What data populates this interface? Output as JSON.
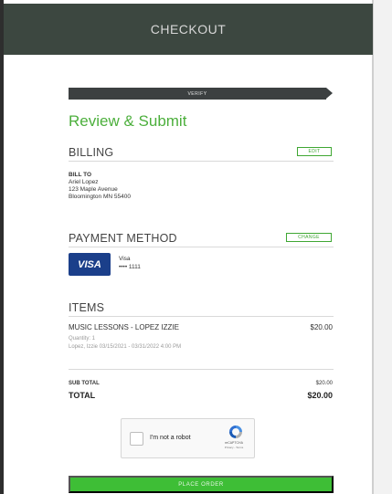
{
  "header": {
    "title": "CHECKOUT"
  },
  "steps": {
    "current": "VERIFY"
  },
  "page": {
    "title": "Review & Submit"
  },
  "billing": {
    "heading": "BILLING",
    "edit_label": "EDIT",
    "bill_to_label": "BILL TO",
    "name": "Ariel Lopez",
    "street": "123 Maple Avenue",
    "city_line": "Bloomington MN 55400"
  },
  "payment": {
    "heading": "PAYMENT METHOD",
    "change_label": "CHANGE",
    "card_brand_logo": "VISA",
    "card_type": "Visa",
    "card_masked": "•••• 1111"
  },
  "items": {
    "heading": "ITEMS",
    "list": [
      {
        "name": "MUSIC LESSONS - LOPEZ IZZIE",
        "price": "$20.00",
        "quantity": "Quantity: 1",
        "schedule": "Lopez, Izzie 03/15/2021 - 03/31/2022 4:00 PM"
      }
    ]
  },
  "summary": {
    "subtotal_label": "SUB TOTAL",
    "subtotal_value": "$20.00",
    "total_label": "TOTAL",
    "total_value": "$20.00"
  },
  "recaptcha": {
    "label": "I'm not a robot",
    "brand": "reCAPTCHA",
    "links": "Privacy - Terms",
    "icon": "recaptcha-logo-icon"
  },
  "actions": {
    "place_order_label": "PLACE ORDER"
  },
  "colors": {
    "accent": "#3ebe36",
    "header_bg": "#3c4740",
    "visa_blue": "#1b3f8a"
  }
}
